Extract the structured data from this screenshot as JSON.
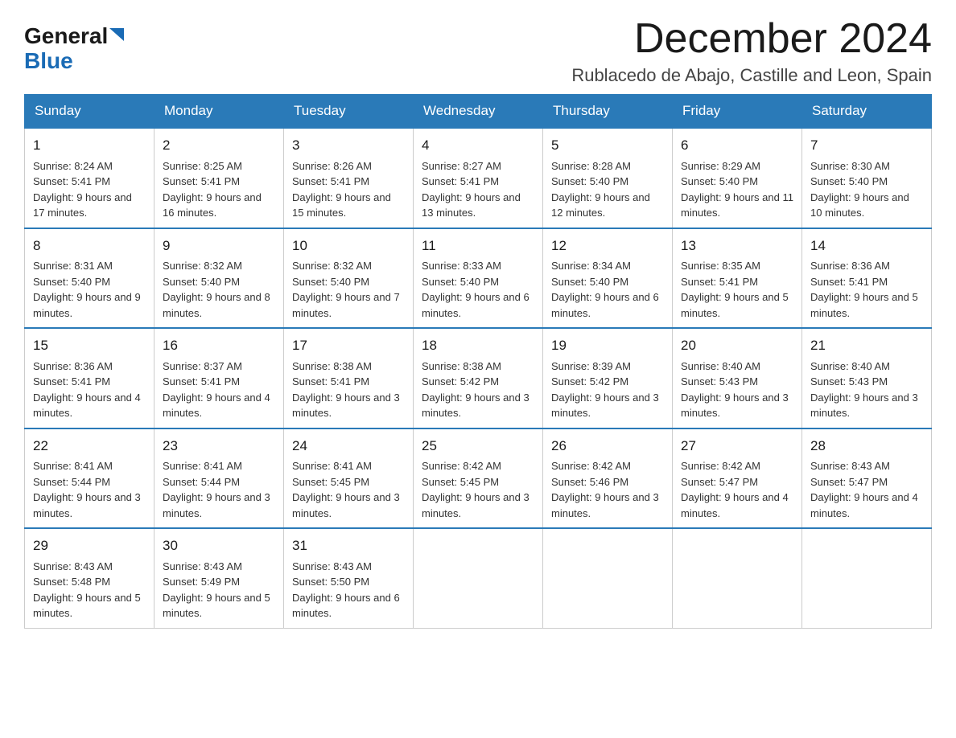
{
  "header": {
    "logo_general": "General",
    "logo_blue": "Blue",
    "month_title": "December 2024",
    "location": "Rublacedo de Abajo, Castille and Leon, Spain"
  },
  "days_of_week": [
    "Sunday",
    "Monday",
    "Tuesday",
    "Wednesday",
    "Thursday",
    "Friday",
    "Saturday"
  ],
  "weeks": [
    [
      {
        "day": "1",
        "sunrise": "8:24 AM",
        "sunset": "5:41 PM",
        "daylight": "9 hours and 17 minutes."
      },
      {
        "day": "2",
        "sunrise": "8:25 AM",
        "sunset": "5:41 PM",
        "daylight": "9 hours and 16 minutes."
      },
      {
        "day": "3",
        "sunrise": "8:26 AM",
        "sunset": "5:41 PM",
        "daylight": "9 hours and 15 minutes."
      },
      {
        "day": "4",
        "sunrise": "8:27 AM",
        "sunset": "5:41 PM",
        "daylight": "9 hours and 13 minutes."
      },
      {
        "day": "5",
        "sunrise": "8:28 AM",
        "sunset": "5:40 PM",
        "daylight": "9 hours and 12 minutes."
      },
      {
        "day": "6",
        "sunrise": "8:29 AM",
        "sunset": "5:40 PM",
        "daylight": "9 hours and 11 minutes."
      },
      {
        "day": "7",
        "sunrise": "8:30 AM",
        "sunset": "5:40 PM",
        "daylight": "9 hours and 10 minutes."
      }
    ],
    [
      {
        "day": "8",
        "sunrise": "8:31 AM",
        "sunset": "5:40 PM",
        "daylight": "9 hours and 9 minutes."
      },
      {
        "day": "9",
        "sunrise": "8:32 AM",
        "sunset": "5:40 PM",
        "daylight": "9 hours and 8 minutes."
      },
      {
        "day": "10",
        "sunrise": "8:32 AM",
        "sunset": "5:40 PM",
        "daylight": "9 hours and 7 minutes."
      },
      {
        "day": "11",
        "sunrise": "8:33 AM",
        "sunset": "5:40 PM",
        "daylight": "9 hours and 6 minutes."
      },
      {
        "day": "12",
        "sunrise": "8:34 AM",
        "sunset": "5:40 PM",
        "daylight": "9 hours and 6 minutes."
      },
      {
        "day": "13",
        "sunrise": "8:35 AM",
        "sunset": "5:41 PM",
        "daylight": "9 hours and 5 minutes."
      },
      {
        "day": "14",
        "sunrise": "8:36 AM",
        "sunset": "5:41 PM",
        "daylight": "9 hours and 5 minutes."
      }
    ],
    [
      {
        "day": "15",
        "sunrise": "8:36 AM",
        "sunset": "5:41 PM",
        "daylight": "9 hours and 4 minutes."
      },
      {
        "day": "16",
        "sunrise": "8:37 AM",
        "sunset": "5:41 PM",
        "daylight": "9 hours and 4 minutes."
      },
      {
        "day": "17",
        "sunrise": "8:38 AM",
        "sunset": "5:41 PM",
        "daylight": "9 hours and 3 minutes."
      },
      {
        "day": "18",
        "sunrise": "8:38 AM",
        "sunset": "5:42 PM",
        "daylight": "9 hours and 3 minutes."
      },
      {
        "day": "19",
        "sunrise": "8:39 AM",
        "sunset": "5:42 PM",
        "daylight": "9 hours and 3 minutes."
      },
      {
        "day": "20",
        "sunrise": "8:40 AM",
        "sunset": "5:43 PM",
        "daylight": "9 hours and 3 minutes."
      },
      {
        "day": "21",
        "sunrise": "8:40 AM",
        "sunset": "5:43 PM",
        "daylight": "9 hours and 3 minutes."
      }
    ],
    [
      {
        "day": "22",
        "sunrise": "8:41 AM",
        "sunset": "5:44 PM",
        "daylight": "9 hours and 3 minutes."
      },
      {
        "day": "23",
        "sunrise": "8:41 AM",
        "sunset": "5:44 PM",
        "daylight": "9 hours and 3 minutes."
      },
      {
        "day": "24",
        "sunrise": "8:41 AM",
        "sunset": "5:45 PM",
        "daylight": "9 hours and 3 minutes."
      },
      {
        "day": "25",
        "sunrise": "8:42 AM",
        "sunset": "5:45 PM",
        "daylight": "9 hours and 3 minutes."
      },
      {
        "day": "26",
        "sunrise": "8:42 AM",
        "sunset": "5:46 PM",
        "daylight": "9 hours and 3 minutes."
      },
      {
        "day": "27",
        "sunrise": "8:42 AM",
        "sunset": "5:47 PM",
        "daylight": "9 hours and 4 minutes."
      },
      {
        "day": "28",
        "sunrise": "8:43 AM",
        "sunset": "5:47 PM",
        "daylight": "9 hours and 4 minutes."
      }
    ],
    [
      {
        "day": "29",
        "sunrise": "8:43 AM",
        "sunset": "5:48 PM",
        "daylight": "9 hours and 5 minutes."
      },
      {
        "day": "30",
        "sunrise": "8:43 AM",
        "sunset": "5:49 PM",
        "daylight": "9 hours and 5 minutes."
      },
      {
        "day": "31",
        "sunrise": "8:43 AM",
        "sunset": "5:50 PM",
        "daylight": "9 hours and 6 minutes."
      },
      null,
      null,
      null,
      null
    ]
  ]
}
